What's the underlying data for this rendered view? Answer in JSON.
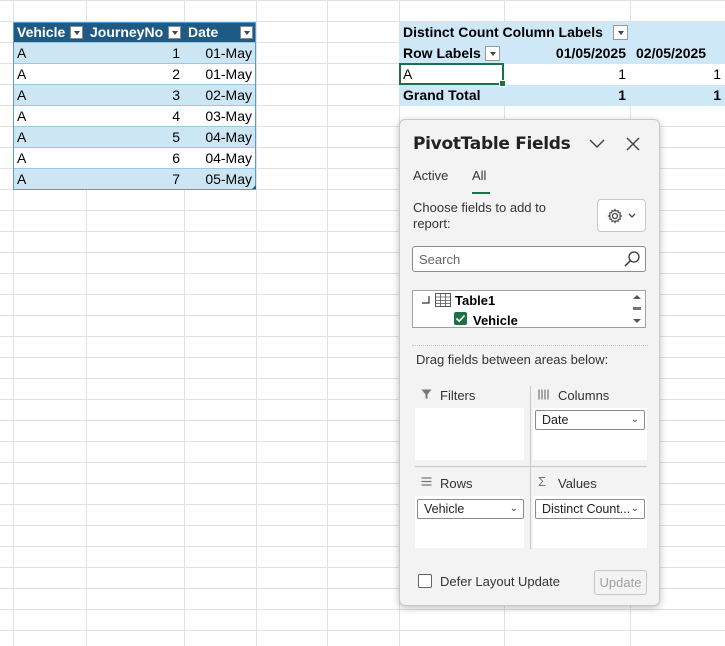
{
  "source_table": {
    "headers": [
      "Vehicle",
      "JourneyNo",
      "Date"
    ],
    "rows": [
      [
        "A",
        "1",
        "01-May"
      ],
      [
        "A",
        "2",
        "01-May"
      ],
      [
        "A",
        "3",
        "02-May"
      ],
      [
        "A",
        "4",
        "03-May"
      ],
      [
        "A",
        "5",
        "04-May"
      ],
      [
        "A",
        "6",
        "04-May"
      ],
      [
        "A",
        "7",
        "05-May"
      ]
    ]
  },
  "pivot": {
    "measure_label": "Distinct Count",
    "column_labels_label": "Column Labels",
    "row_labels_label": "Row Labels",
    "column_headers": [
      "01/05/2025",
      "02/05/2025"
    ],
    "rows": [
      {
        "label": "A",
        "values": [
          "1",
          "1"
        ]
      }
    ],
    "grand_total": {
      "label": "Grand Total",
      "values": [
        "1",
        "1"
      ]
    }
  },
  "fields_pane": {
    "title": "PivotTable Fields",
    "tabs": [
      "Active",
      "All"
    ],
    "active_tab": "All",
    "choose_text": "Choose fields to add to report:",
    "search_placeholder": "Search",
    "tree": {
      "table_name": "Table1",
      "fields": [
        {
          "name": "Vehicle",
          "checked": true
        }
      ]
    },
    "drag_hint": "Drag fields between areas below:",
    "areas": {
      "filters": {
        "label": "Filters",
        "items": []
      },
      "columns": {
        "label": "Columns",
        "items": [
          "Date"
        ]
      },
      "rows": {
        "label": "Rows",
        "items": [
          "Vehicle"
        ]
      },
      "values": {
        "label": "Values",
        "items": [
          "Distinct Count..."
        ]
      }
    },
    "defer_label": "Defer Layout Update",
    "update_label": "Update"
  },
  "colors": {
    "table_header": "#1f5a85",
    "table_band": "#cde6f4",
    "pivot_header": "#cfe8f7",
    "accent_green": "#1e7145"
  }
}
